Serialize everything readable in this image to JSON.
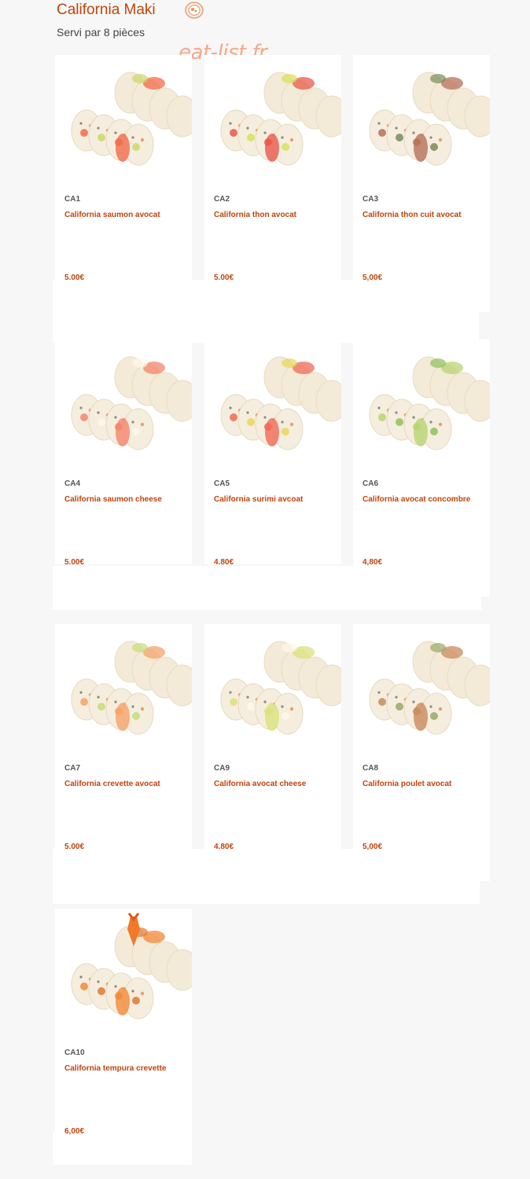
{
  "header": {
    "title": "California Maki",
    "subtitle": "Servi par 8 pièces",
    "watermark": "eat-list.fr"
  },
  "colors": {
    "accent": "#c0440e",
    "price": "#c0440e",
    "code": "#555555",
    "watermark": "#f5a98a"
  },
  "products": [
    {
      "code": "CA1",
      "name": "California saumon avocat",
      "price": "5,00€",
      "filling": "salmon-avocado"
    },
    {
      "code": "CA2",
      "name": "California thon avocat",
      "price": "5,00€",
      "filling": "tuna-avocado"
    },
    {
      "code": "CA3",
      "name": "California thon cuit avocat",
      "price": "5,00€",
      "filling": "cooked-tuna-avocado"
    },
    {
      "code": "CA4",
      "name": "California saumon cheese",
      "price": "5,00€",
      "filling": "salmon-cheese"
    },
    {
      "code": "CA5",
      "name": "California surimi avcoat",
      "price": "4,80€",
      "filling": "surimi-avocado"
    },
    {
      "code": "CA6",
      "name": "California avocat concombre",
      "price": "4,80€",
      "filling": "avocado-cucumber"
    },
    {
      "code": "CA7",
      "name": "California crevette avocat",
      "price": "5,00€",
      "filling": "shrimp-avocado"
    },
    {
      "code": "CA9",
      "name": "California avocat cheese",
      "price": "4,80€",
      "filling": "avocado-cheese"
    },
    {
      "code": "CA8",
      "name": "California poulet avocat",
      "price": "5,00€",
      "filling": "chicken-avocado"
    },
    {
      "code": "CA10",
      "name": "California tempura crevette",
      "price": "6,00€",
      "filling": "tempura-shrimp"
    }
  ]
}
